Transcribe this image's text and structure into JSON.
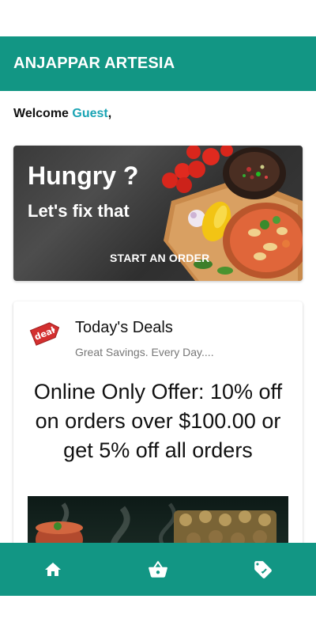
{
  "header": {
    "title": "ANJAPPAR ARTESIA"
  },
  "welcome": {
    "prefix": "Welcome ",
    "name": "Guest",
    "suffix": ","
  },
  "hero": {
    "headline": "Hungry ?",
    "subheadline": "Let's fix that",
    "cta_label": "START AN ORDER"
  },
  "deals": {
    "badge_text": "deal",
    "title": "Today's Deals",
    "subtitle": "Great Savings. Every Day....",
    "offer": "Online Only Offer: 10% off on orders over $100.00 or get 5% off all orders"
  },
  "bottom_nav": {
    "items": [
      {
        "icon": "home-icon"
      },
      {
        "icon": "basket-icon"
      },
      {
        "icon": "tag-icon"
      }
    ]
  },
  "colors": {
    "primary": "#129684",
    "accent": "#1aa4b4",
    "deal_red": "#d32f2f"
  }
}
